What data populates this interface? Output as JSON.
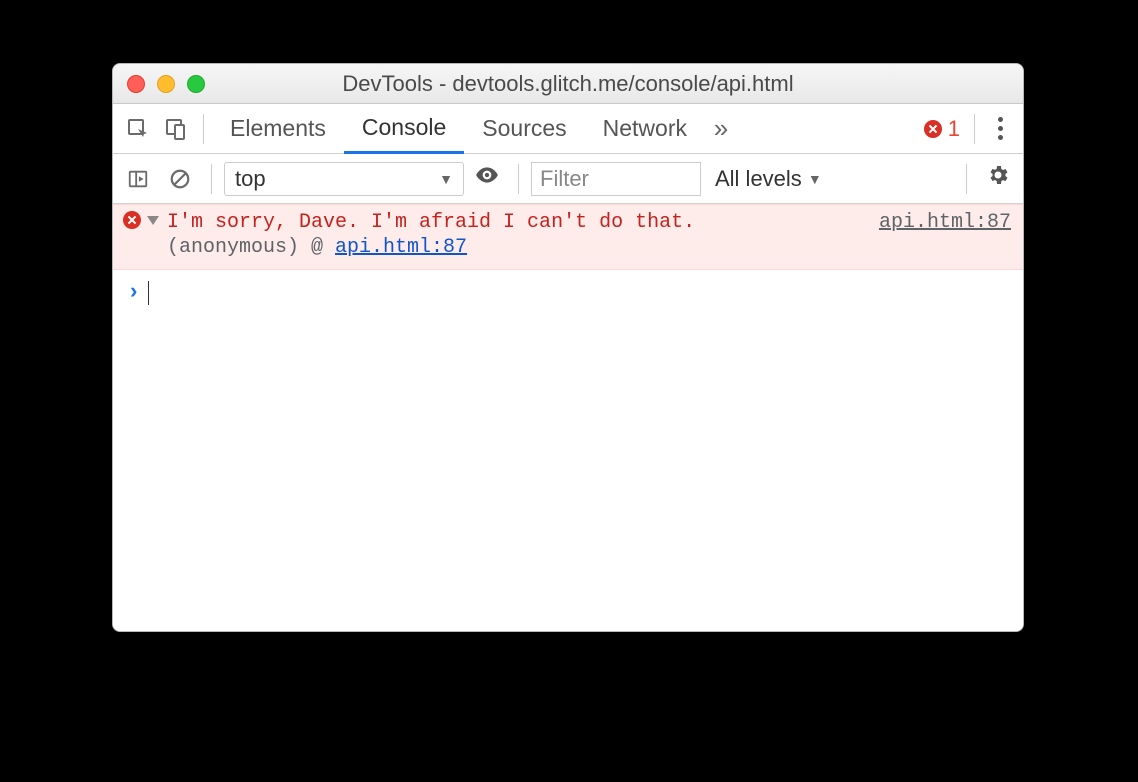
{
  "window": {
    "title": "DevTools - devtools.glitch.me/console/api.html"
  },
  "mainbar": {
    "tabs": [
      "Elements",
      "Console",
      "Sources",
      "Network"
    ],
    "active_tab_index": 1,
    "overflow_glyph": "»",
    "error_count": "1"
  },
  "filterbar": {
    "context": "top",
    "filter_placeholder": "Filter",
    "levels_label": "All levels"
  },
  "console": {
    "error": {
      "text": "I'm sorry, Dave. I'm afraid I can't do that.",
      "source_link": "api.html:87",
      "stack_prefix": "(anonymous) @ ",
      "stack_link": "api.html:87"
    },
    "prompt_glyph": "›"
  }
}
